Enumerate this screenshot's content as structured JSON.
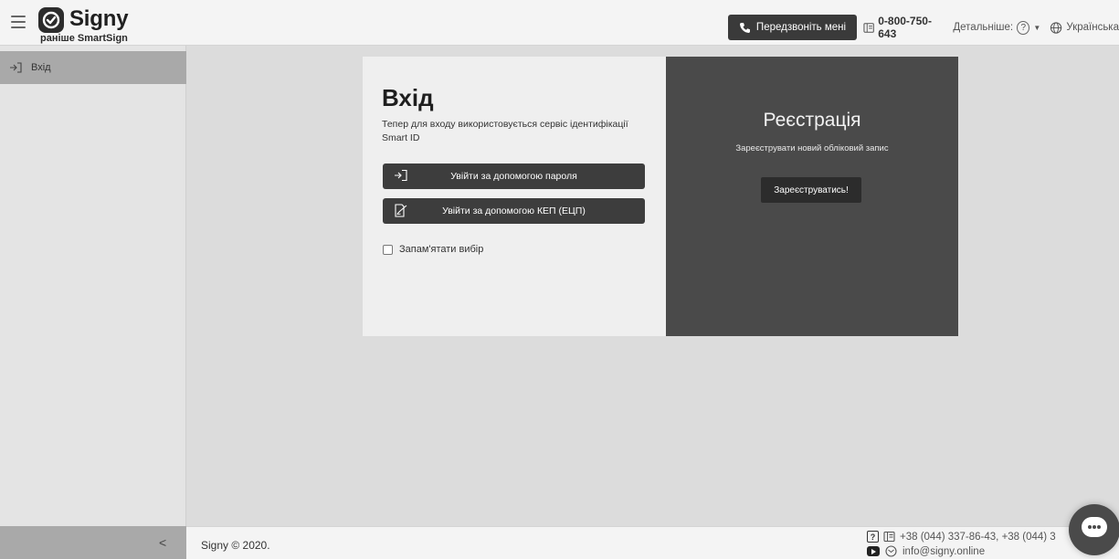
{
  "header": {
    "brand_name": "Signy",
    "brand_subtitle": "раніше SmartSign",
    "callback_label": "Передзвоніть мені",
    "phone": "0-800-750-643",
    "details_label": "Детальніше:",
    "help_symbol": "?",
    "language": "Українська"
  },
  "sidebar": {
    "items": [
      {
        "label": "Вхід",
        "icon": "login-arrow-icon"
      }
    ],
    "collapse_icon": "chevron-left-icon"
  },
  "login": {
    "title": "Вхід",
    "description": "Тепер для входу використовується сервіс ідентифікації Smart ID",
    "password_button": "Увійти за допомогою пароля",
    "kep_button": "Увійти за допомогою КЕП (ЕЦП)",
    "remember_label": "Запам'ятати вибір"
  },
  "registration": {
    "title": "Реєстрація",
    "description": "Зареєструвати новий обліковий запис",
    "button": "Зареєструватись!"
  },
  "footer": {
    "copyright": "Signy © 2020.",
    "phones": "+38 (044) 337-86-43, +38 (044) 3",
    "email": "info@signy.online"
  },
  "colors": {
    "dark_panel": "#4a4a4a",
    "button_dark": "#3d3d3d",
    "sidebar_active": "#a9a9a9"
  }
}
